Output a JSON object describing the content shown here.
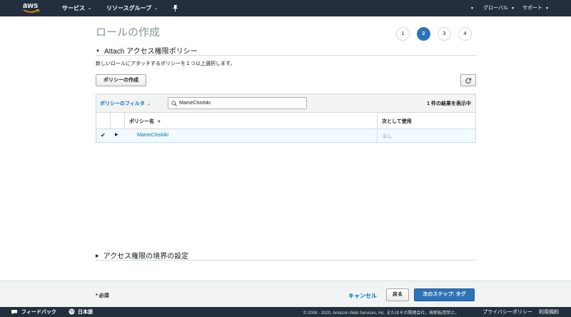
{
  "topnav": {
    "logo": "aws",
    "services": "サービス",
    "resource_groups": "リソースグループ",
    "pin_icon": "pin-icon",
    "account": "",
    "region": "グローバル",
    "support": "サポート",
    "bg_color": "#232f3e"
  },
  "page": {
    "title": "ロールの作成",
    "steps": [
      "1",
      "2",
      "3",
      "4"
    ],
    "active_step": 2
  },
  "attach": {
    "heading": "Attach アクセス権限ポリシー",
    "description": "新しいロールにアタッチするポリシーを１つ以上選択します。",
    "create_policy_button": "ポリシーの作成",
    "refresh_icon": "refresh-icon"
  },
  "table": {
    "filter_label": "ポリシーのフィルタ",
    "search_value": "MameChishiki",
    "result_count": "1 件の結果を表示中",
    "columns": [
      "ポリシー名",
      "次として使用"
    ],
    "rows": [
      {
        "selected": true,
        "name": "MameChishiki",
        "used_as": "なし"
      }
    ]
  },
  "boundary": {
    "heading": "アクセス権限の境界の設定"
  },
  "footer": {
    "required": "* 必須",
    "cancel": "キャンセル",
    "back": "戻る",
    "next": "次のステップ: タグ",
    "primary_color": "#2e73b8"
  },
  "bottombar": {
    "feedback": "フィードバック",
    "language": "日本語",
    "copyright": "© 2008 - 2020, Amazon Web Services, Inc. またはその関連会社。無断転用禁止。",
    "privacy": "プライバシーポリシー",
    "terms": "利用規約"
  }
}
